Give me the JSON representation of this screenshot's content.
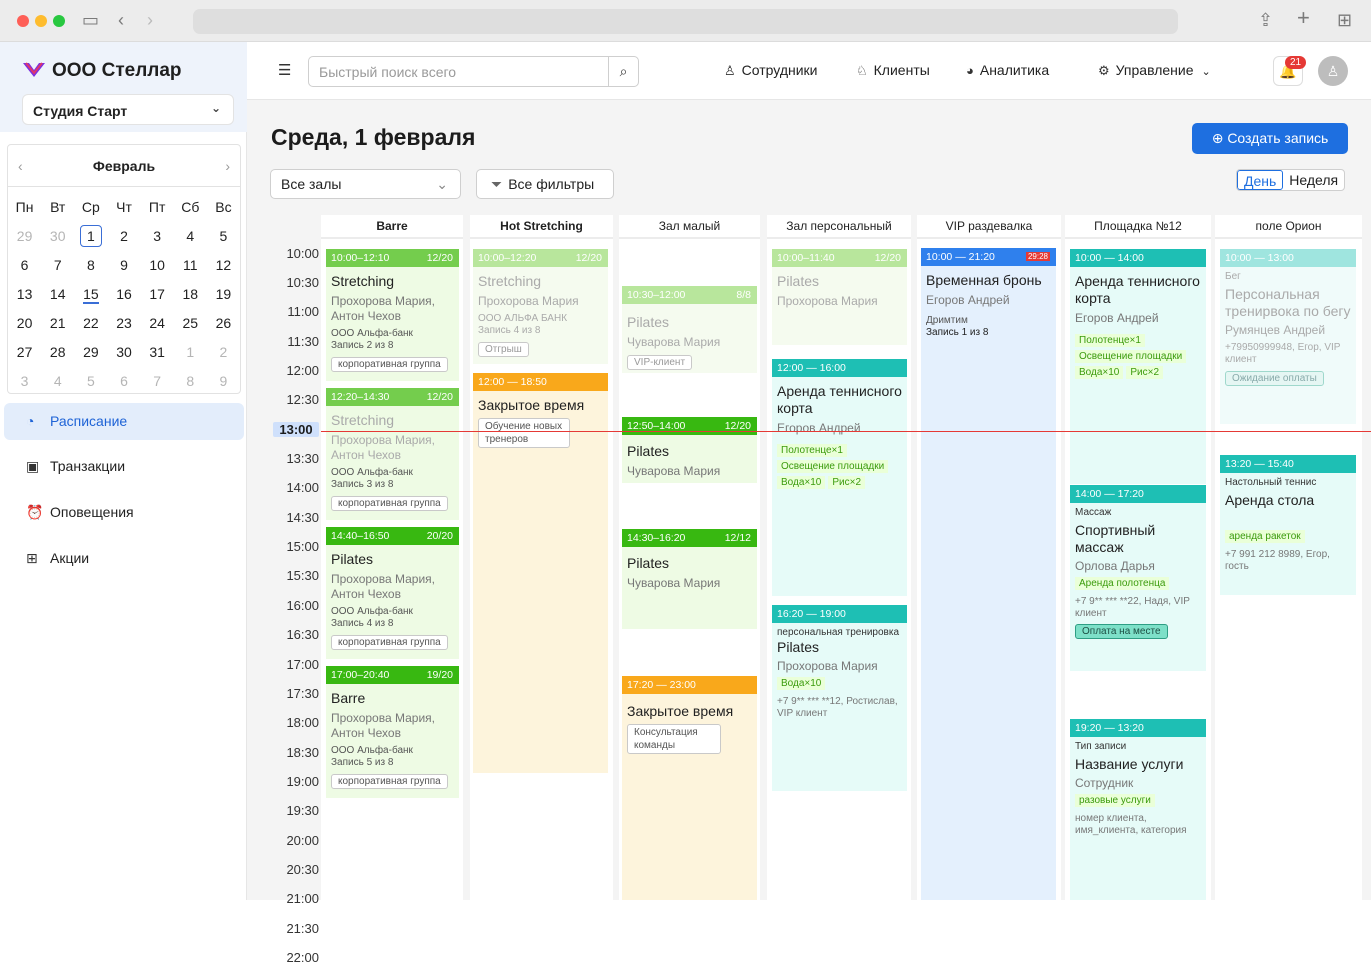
{
  "browser": {
    "address": ""
  },
  "sidebar": {
    "company": "ООО Стеллар",
    "studio": "Студия Старт",
    "calendar": {
      "month": "Февраль",
      "weekdays": [
        "Пн",
        "Вт",
        "Ср",
        "Чт",
        "Пт",
        "Сб",
        "Вс"
      ],
      "weeks": [
        [
          "29",
          "30",
          "1",
          "2",
          "3",
          "4",
          "5"
        ],
        [
          "6",
          "7",
          "8",
          "9",
          "10",
          "11",
          "12"
        ],
        [
          "13",
          "14",
          "15",
          "16",
          "17",
          "18",
          "19"
        ],
        [
          "20",
          "21",
          "22",
          "23",
          "24",
          "25",
          "26"
        ],
        [
          "27",
          "28",
          "29",
          "30",
          "31",
          "1",
          "2"
        ],
        [
          "3",
          "4",
          "5",
          "6",
          "7",
          "8",
          "9"
        ]
      ]
    },
    "menu": [
      {
        "label": "Расписание",
        "icon": "dashboard-icon"
      },
      {
        "label": "Транзакции",
        "icon": "wallet-icon"
      },
      {
        "label": "Оповещения",
        "icon": "alarm-icon"
      },
      {
        "label": "Акции",
        "icon": "gift-icon"
      }
    ]
  },
  "topbar": {
    "search_placeholder": "Быстрый поиск всего",
    "nav": [
      "Сотрудники",
      "Клиенты",
      "Аналитика",
      "Управление"
    ],
    "notifications": "21"
  },
  "main": {
    "title": "Среда, 1 февраля",
    "create_button": "Создать запись",
    "halls_select": "Все залы",
    "filters_button": "Все фильтры",
    "view_day": "День",
    "view_week": "Неделя",
    "current_time": "13:00",
    "times": [
      "10:00",
      "10:30",
      "11:00",
      "11:30",
      "12:00",
      "12:30",
      "13:00",
      "13:30",
      "14:00",
      "14:30",
      "15:00",
      "15:30",
      "16:00",
      "16:30",
      "17:00",
      "17:30",
      "18:00",
      "18:30",
      "19:00",
      "19:30",
      "20:00",
      "20:30",
      "21:00",
      "21:30",
      "22:00"
    ],
    "columns": [
      "Barre",
      "Hot Stretching",
      "Зал малый",
      "Зал персональный",
      "VIP раздевалка",
      "Площадка №12",
      "поле Орион"
    ]
  },
  "events": [
    {
      "time": "10:00–12:10",
      "count": "12/20",
      "title": "Stretching",
      "people": "Прохорова Мария, Антон Чехов",
      "sub": "ООО Альфа-банк",
      "sub2": "Запись 2 из 8",
      "tag": "корпоративная группа"
    },
    {
      "time": "12:20–14:30",
      "count": "12/20",
      "title": "Stretching",
      "people": "Прохорова Мария, Антон Чехов",
      "sub": "ООО Альфа-банк",
      "sub2": "Запись 3 из 8",
      "tag": "корпоративная группа"
    },
    {
      "time": "14:40–16:50",
      "count": "20/20",
      "title": "Pilates",
      "people": "Прохорова Мария, Антон Чехов",
      "sub": "ООО Альфа-банк",
      "sub2": "Запись 4 из 8",
      "tag": "корпоративная группа"
    },
    {
      "time": "17:00–20:40",
      "count": "19/20",
      "title": "Barre",
      "people": "Прохорова Мария, Антон Чехов",
      "sub": "ООО Альфа-банк",
      "sub2": "Запись 5 из 8",
      "tag": "корпоративная группа"
    },
    {
      "time": "10:00–12:20",
      "count": "12/20",
      "title": "Stretching",
      "people": "Прохорова Мария",
      "sub": "ООО АЛЬФА БАНК",
      "sub2": "Запись 4 из 8",
      "tag": "Отгрыш"
    },
    {
      "time": "12:00 — 18:50",
      "title": "Закрытое время",
      "tag": "Обучение новых тренеров"
    },
    {
      "time": "10:30–12:00",
      "count": "8/8",
      "title": "Pilates",
      "people": "Чуварова Мария",
      "tag": "VIP-клиент"
    },
    {
      "time": "12:50–14:00",
      "count": "12/20",
      "title": "Pilates",
      "people": "Чуварова Мария"
    },
    {
      "time": "14:30–16:20",
      "count": "12/12",
      "title": "Pilates",
      "people": "Чуварова Мария"
    },
    {
      "time": "17:20 — 23:00",
      "title": "Закрытое время",
      "tag": "Консультация команды"
    },
    {
      "time": "10:00–11:40",
      "count": "12/20",
      "title": "Pilates",
      "people": "Прохорова Мария"
    },
    {
      "time": "12:00 — 16:00",
      "title": "Аренда теннисного корта",
      "people": "Егоров Андрей",
      "g1": "Полотенце×1",
      "g2": "Освещение площадки",
      "g3": "Вода×10",
      "g4": "Рис×2"
    },
    {
      "time": "16:20 — 19:00",
      "pre": "персональная тренировка",
      "title": "Pilates",
      "people": "Прохорова Мария",
      "g1": "Вода×10",
      "sub": "+7 9** *** **12, Ростислав, VIP клиент"
    },
    {
      "time": "10:00 — 21:20",
      "flag": "29:28",
      "title": "Временная бронь",
      "people": "Егоров Андрей",
      "sub": "Дримтим",
      "sub2": "Запись 1 из 8"
    },
    {
      "time": "10:00 — 14:00",
      "title": "Аренда теннисного корта",
      "people": "Егоров Андрей",
      "g1": "Полотенце×1",
      "g2": "Освещение площадки",
      "g3": "Вода×10",
      "g4": "Рис×2"
    },
    {
      "time": "14:00 — 17:20",
      "pre": "Массаж",
      "title": "Спортивный массаж",
      "people": "Орлова Дарья",
      "g1": "Аренда полотенца",
      "sub": "+7 9** *** **22, Надя, VIP клиент",
      "tag": "Оплата на месте"
    },
    {
      "time": "19:20 — 13:20",
      "pre": "Тип записи",
      "title": "Название услуги",
      "people": "Сотрудник",
      "g1": "разовые услуги",
      "sub": "номер клиента, имя_клиента, категория"
    },
    {
      "time": "10:00 — 13:00",
      "pre": "Бег",
      "title": "Персональная тренирвока по бегу",
      "people": "Румянцев Андрей",
      "sub": "+79950999948, Егор, VIP клиент",
      "tag": "Ожидание оплаты"
    },
    {
      "time": "13:20 — 15:40",
      "pre": "Настольный теннис",
      "title": "Аренда стола",
      "g1": "аренда ракеток",
      "sub": "+7 991 212 8989, Егор, гость"
    }
  ]
}
